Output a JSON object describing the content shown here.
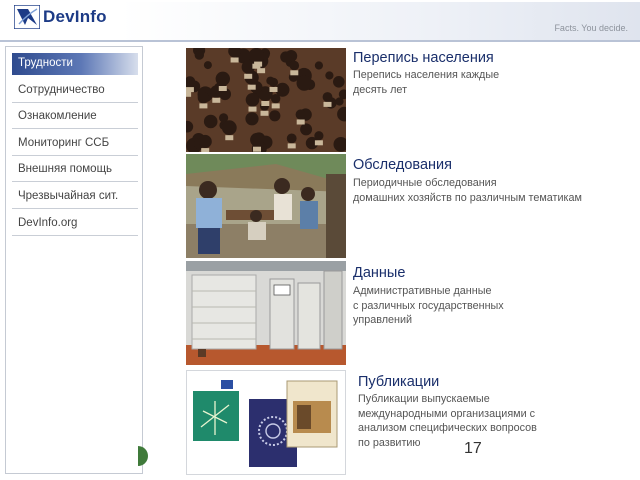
{
  "header": {
    "logo_text": "DevInfo",
    "tagline": "Facts. You decide."
  },
  "sidebar": {
    "items": [
      {
        "label": "Трудности",
        "active": true
      },
      {
        "label": "Сотрудничество",
        "active": false
      },
      {
        "label": "Ознакомление",
        "active": false
      },
      {
        "label": "Мониторинг ССБ",
        "active": false
      },
      {
        "label": "Внешняя помощь",
        "active": false
      },
      {
        "label": "Чрезвычайная сит.",
        "active": false
      },
      {
        "label": "DevInfo.org",
        "active": false
      }
    ]
  },
  "sections": [
    {
      "title": "Перепись населения",
      "desc_lines": [
        "Перепись населения каждые",
        "десять лет"
      ]
    },
    {
      "title": "Обследования",
      "desc_lines": [
        "Периодичные обследования",
        "домашних хозяйств по различным тематикам"
      ]
    },
    {
      "title": "Данные",
      "desc_lines": [
        "Административные данные",
        "с различных государственных",
        "управлений"
      ]
    },
    {
      "title": "Публикации",
      "desc_lines": [
        "Публикации выпускаемые",
        "международными организациями с",
        "анализом специфических вопросов",
        "по развитию"
      ]
    }
  ],
  "page_number": "17",
  "colors": {
    "brand": "#1d3b86",
    "accent": "#2f4b8e",
    "title": "#1a2f6b"
  }
}
